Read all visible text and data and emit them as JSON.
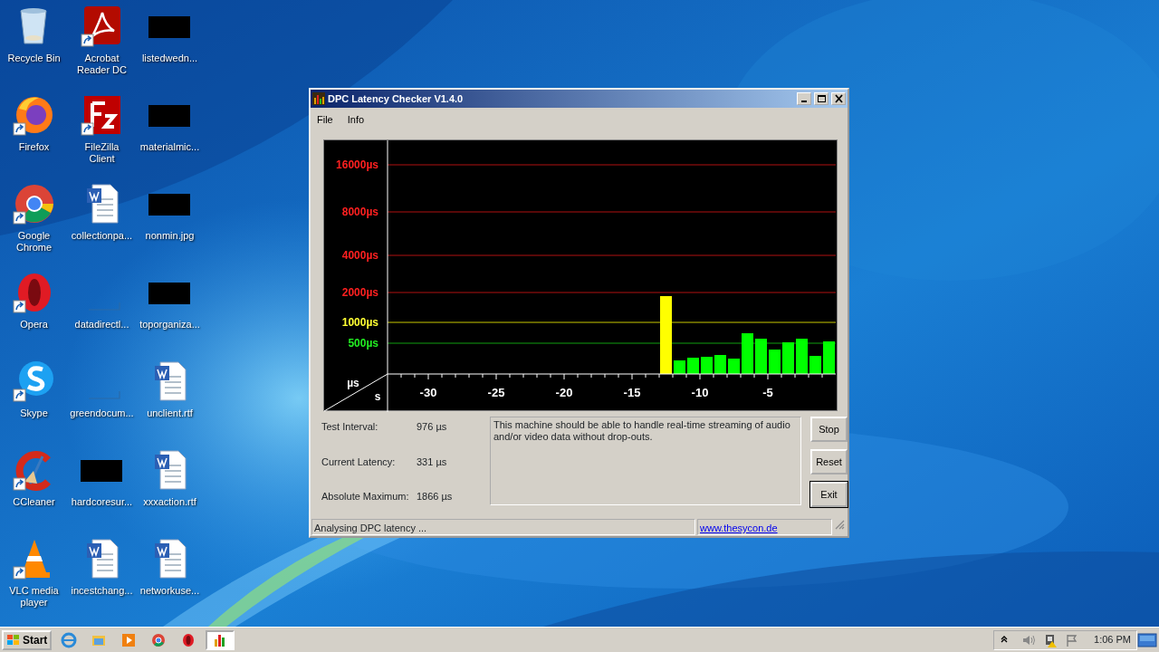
{
  "desktop_icons": [
    {
      "label": "Recycle Bin",
      "kind": "recycle",
      "shortcut": false
    },
    {
      "label": "Firefox",
      "kind": "firefox",
      "shortcut": true
    },
    {
      "label": "Google Chrome",
      "kind": "chrome",
      "shortcut": true
    },
    {
      "label": "Opera",
      "kind": "opera",
      "shortcut": true
    },
    {
      "label": "Skype",
      "kind": "skype",
      "shortcut": true
    },
    {
      "label": "CCleaner",
      "kind": "ccleaner",
      "shortcut": true
    },
    {
      "label": "VLC media player",
      "kind": "vlc",
      "shortcut": true
    },
    {
      "label": "Acrobat Reader DC",
      "kind": "acrobat",
      "shortcut": true
    },
    {
      "label": "FileZilla Client",
      "kind": "filezilla",
      "shortcut": true
    },
    {
      "label": "collectionpa...",
      "kind": "word",
      "shortcut": false
    },
    {
      "label": "datadirectl...",
      "kind": "blank",
      "shortcut": false
    },
    {
      "label": "greendocum...",
      "kind": "blank",
      "shortcut": false
    },
    {
      "label": "hardcoresur...",
      "kind": "thumbnail",
      "shortcut": false
    },
    {
      "label": "incestchang...",
      "kind": "word",
      "shortcut": false
    },
    {
      "label": "listedwedn...",
      "kind": "thumbnail",
      "shortcut": false
    },
    {
      "label": "materialmic...",
      "kind": "thumbnail",
      "shortcut": false
    },
    {
      "label": "nonmin.jpg",
      "kind": "thumbnail",
      "shortcut": false
    },
    {
      "label": "toporganiza...",
      "kind": "thumbnail",
      "shortcut": false
    },
    {
      "label": "unclient.rtf",
      "kind": "word",
      "shortcut": false
    },
    {
      "label": "xxxaction.rtf",
      "kind": "word",
      "shortcut": false
    },
    {
      "label": "networkuse...",
      "kind": "word",
      "shortcut": false
    }
  ],
  "window": {
    "title": "DPC Latency Checker V1.4.0",
    "menu": [
      "File",
      "Info"
    ],
    "graph": {
      "y_labels": [
        {
          "text": "16000µs",
          "kind": "high"
        },
        {
          "text": "8000µs",
          "kind": "high"
        },
        {
          "text": "4000µs",
          "kind": "high"
        },
        {
          "text": "2000µs",
          "kind": "high"
        },
        {
          "text": "1000µs",
          "kind": "medium"
        },
        {
          "text": "500µs",
          "kind": "low"
        }
      ],
      "x_labels": [
        "-30",
        "-25",
        "-20",
        "-15",
        "-10",
        "-5"
      ],
      "y_unit": "µs",
      "x_unit": "s"
    },
    "stats": [
      {
        "label": "Test Interval:",
        "value": "976 µs"
      },
      {
        "label": "Current Latency:",
        "value": "331 µs"
      },
      {
        "label": "Absolute Maximum:",
        "value": "1866 µs"
      }
    ],
    "message": "This machine should be able to handle real-time streaming of audio and/or video data without drop-outs.",
    "buttons": [
      {
        "label": "Stop",
        "default": false
      },
      {
        "label": "Reset",
        "default": false
      },
      {
        "label": "Exit",
        "default": true
      }
    ],
    "status_bar": {
      "text": "Analysing DPC latency ...",
      "link": "www.thesycon.de"
    }
  },
  "taskbar": {
    "start": "Start",
    "apps": [
      {
        "kind": "ie",
        "active": false
      },
      {
        "kind": "explorer",
        "active": false
      },
      {
        "kind": "mediaplayer",
        "active": false
      },
      {
        "kind": "chrome",
        "active": false
      },
      {
        "kind": "opera",
        "active": false
      },
      {
        "kind": "dpc",
        "active": true
      }
    ],
    "tray": [
      {
        "kind": "chevron"
      },
      {
        "kind": "speaker"
      },
      {
        "kind": "network"
      },
      {
        "kind": "flag"
      }
    ],
    "clock": "1:06 PM"
  }
}
